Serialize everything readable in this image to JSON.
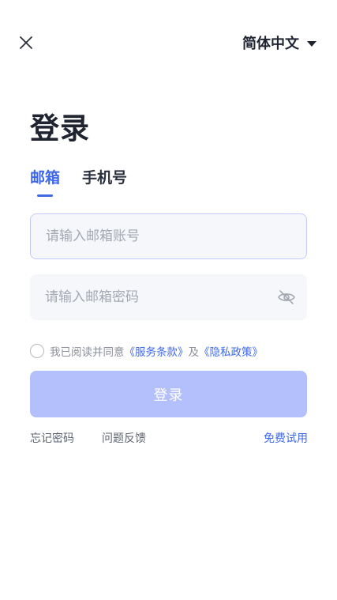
{
  "header": {
    "close_icon": "close-icon",
    "language": "简体中文",
    "language_caret_icon": "caret-down-icon"
  },
  "title": "登录",
  "tabs": [
    {
      "label": "邮箱",
      "active": true
    },
    {
      "label": "手机号",
      "active": false
    }
  ],
  "form": {
    "email": {
      "placeholder": "请输入邮箱账号",
      "value": ""
    },
    "password": {
      "placeholder": "请输入邮箱密码",
      "value": "",
      "toggle_icon": "eye-off-icon"
    }
  },
  "agreement": {
    "checked": false,
    "prefix": "我已阅读并同意",
    "terms_link": "《服务条款》",
    "joiner": "及",
    "privacy_link": "《隐私政策》"
  },
  "login_button": "登录",
  "footer": {
    "forgot_password": "忘记密码",
    "feedback": "问题反馈",
    "free_trial": "免费试用"
  },
  "colors": {
    "accent": "#3f68e9",
    "button_disabled": "#b4c0fb",
    "input_bg": "#f6f7fb"
  }
}
